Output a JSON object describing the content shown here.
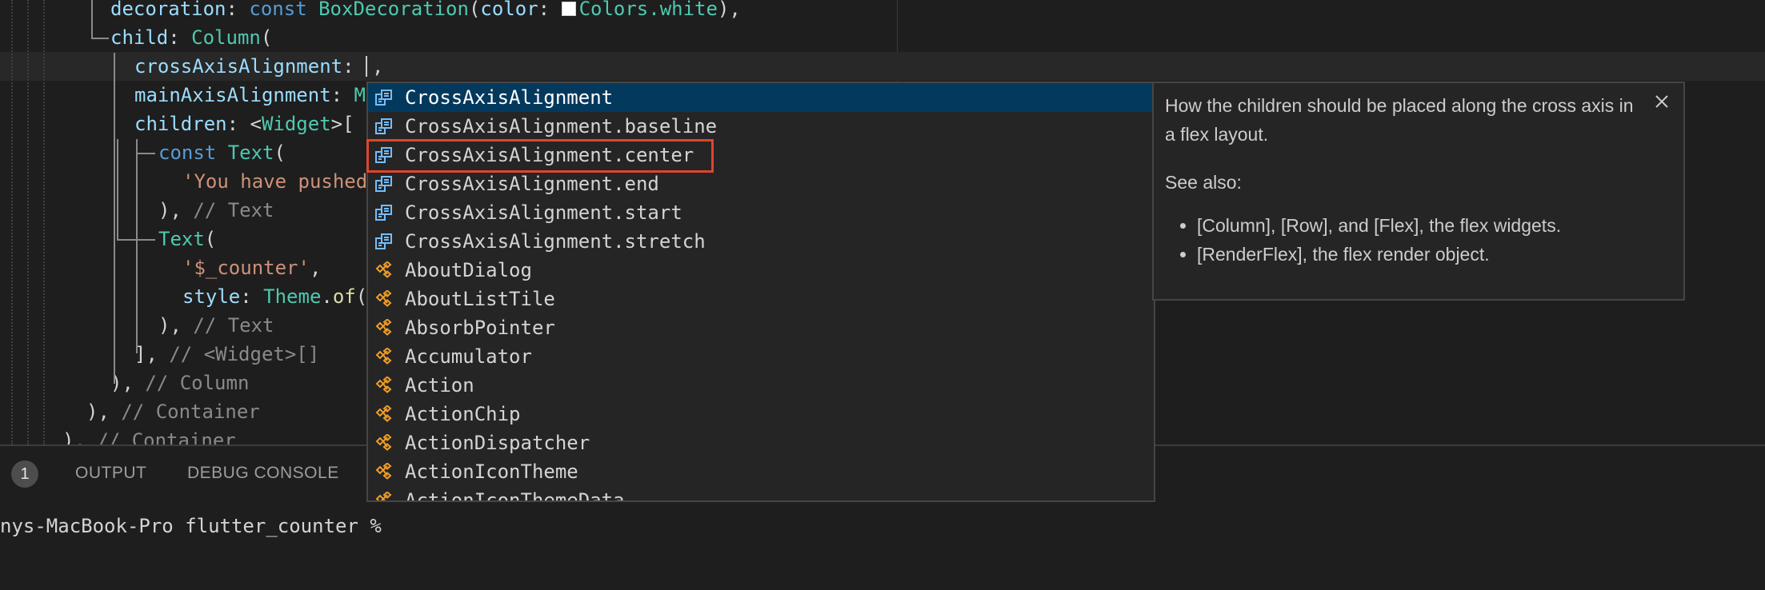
{
  "colors": {
    "keyword": "#569cd6",
    "type": "#4ec9b0",
    "property": "#9cdcfe",
    "string": "#ce9178",
    "comment": "#8a8a8a",
    "function": "#dcdcaa",
    "selected_bg": "#04395e",
    "highlight_box": "#e0452b"
  },
  "editor": {
    "lines": [
      {
        "prop": "decoration",
        "p1": ": ",
        "kw": "const",
        "ty": "BoxDecoration",
        "p2": "(",
        "prop2": "color",
        "p3": ": ",
        "val": "Colors.white",
        "p4": "),"
      },
      {
        "prop": "child",
        "p1": ": ",
        "ty": "Column",
        "p2": "("
      },
      {
        "prop": "crossAxisAlignment",
        "p1": ": ",
        "after_cursor": ","
      },
      {
        "prop": "mainAxisAlignment",
        "p1": ": ",
        "rest": "M"
      },
      {
        "prop": "children",
        "p1": ": <",
        "ty": "Widget",
        "p2": ">["
      },
      {
        "kw": "const",
        "ty": "Text",
        "p2": "("
      },
      {
        "str": "'You have pushed"
      },
      {
        "p1": "), ",
        "cm": "// Text"
      },
      {
        "ty": "Text",
        "p2": "("
      },
      {
        "str": "'$_counter'",
        "p2": ","
      },
      {
        "prop": "style",
        "p1": ": ",
        "ty": "Theme",
        "p2": ".",
        "fn": "of",
        "p3": "("
      },
      {
        "p1": "), ",
        "cm": "// Text"
      },
      {
        "p1": "], ",
        "cm": "// <Widget>[]"
      },
      {
        "p1": "), ",
        "cm": "// Column"
      },
      {
        "p1": "), ",
        "cm": "// Container"
      },
      {
        "p1": "), ",
        "cm": "// Container"
      }
    ]
  },
  "suggestions": {
    "items": [
      {
        "label": "CrossAxisAlignment",
        "icon": "enum-member-icon"
      },
      {
        "label": "CrossAxisAlignment.baseline",
        "icon": "enum-member-icon"
      },
      {
        "label": "CrossAxisAlignment.center",
        "icon": "enum-member-icon"
      },
      {
        "label": "CrossAxisAlignment.end",
        "icon": "enum-member-icon"
      },
      {
        "label": "CrossAxisAlignment.start",
        "icon": "enum-member-icon"
      },
      {
        "label": "CrossAxisAlignment.stretch",
        "icon": "enum-member-icon"
      },
      {
        "label": "AboutDialog",
        "icon": "class-icon"
      },
      {
        "label": "AboutListTile",
        "icon": "class-icon"
      },
      {
        "label": "AbsorbPointer",
        "icon": "class-icon"
      },
      {
        "label": "Accumulator",
        "icon": "class-icon"
      },
      {
        "label": "Action",
        "icon": "class-icon"
      },
      {
        "label": "ActionChip",
        "icon": "class-icon"
      },
      {
        "label": "ActionDispatcher",
        "icon": "class-icon"
      },
      {
        "label": "ActionIconTheme",
        "icon": "class-icon"
      },
      {
        "label": "ActionIconThemeData",
        "icon": "class-icon"
      }
    ],
    "selected_index": 0,
    "highlighted_index": 2
  },
  "doc": {
    "summary": "How the children should be placed along the cross axis in a flex layout.",
    "see_also_heading": "See also:",
    "bullets": [
      "[Column], [Row], and [Flex], the flex widgets.",
      "[RenderFlex], the flex render object."
    ]
  },
  "panel": {
    "problems_count": "1",
    "tabs": [
      "OUTPUT",
      "DEBUG CONSOLE"
    ],
    "terminal_line": "nys-MacBook-Pro flutter_counter %"
  }
}
